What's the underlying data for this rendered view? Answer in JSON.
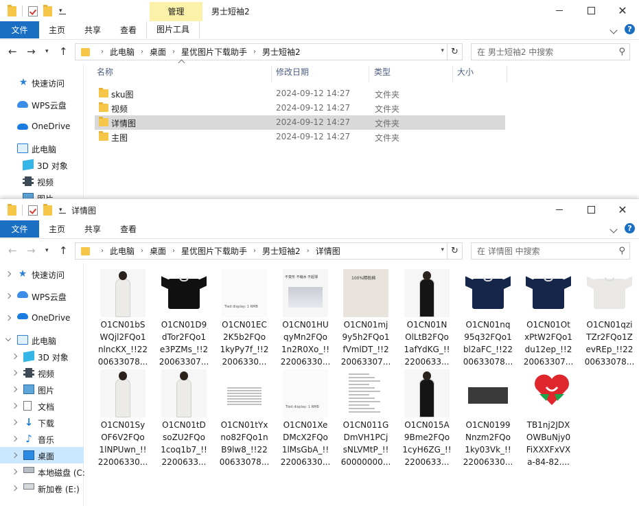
{
  "back_window": {
    "title": "男士短袖2",
    "manage_tab": "管理",
    "tabs": [
      "文件",
      "主页",
      "共享",
      "查看",
      "图片工具"
    ],
    "address": [
      "此电脑",
      "桌面",
      "星优图片下载助手",
      "男士短袖2"
    ],
    "search_placeholder": "在 男士短袖2 中搜索",
    "nav_items": [
      "快速访问",
      "WPS云盘",
      "OneDrive",
      "此电脑",
      "3D 对象",
      "视频",
      "图片"
    ],
    "columns": [
      "名称",
      "修改日期",
      "类型",
      "大小"
    ],
    "rows": [
      {
        "name": "sku图",
        "date": "2024-09-12 14:27",
        "type": "文件夹"
      },
      {
        "name": "视频",
        "date": "2024-09-12 14:27",
        "type": "文件夹"
      },
      {
        "name": "详情图",
        "date": "2024-09-12 14:27",
        "type": "文件夹"
      },
      {
        "name": "主图",
        "date": "2024-09-12 14:27",
        "type": "文件夹"
      }
    ]
  },
  "front_window": {
    "title": "详情图",
    "tabs": [
      "文件",
      "主页",
      "共享",
      "查看"
    ],
    "address": [
      "此电脑",
      "桌面",
      "星优图片下载助手",
      "男士短袖2",
      "详情图"
    ],
    "search_placeholder": "在 详情图 中搜索",
    "nav_items": [
      "快速访问",
      "WPS云盘",
      "OneDrive",
      "此电脑",
      "3D 对象",
      "视频",
      "图片",
      "文档",
      "下载",
      "音乐",
      "桌面",
      "本地磁盘 (C:",
      "新加卷 (E:)"
    ],
    "files": [
      {
        "lines": [
          "O1CN01bS",
          "WQjl2FQo1",
          "nlncKX_!!22",
          "00633078..."
        ],
        "kind": "model-white"
      },
      {
        "lines": [
          "O1CN01D9",
          "dTor2FQo1",
          "e3PZMs_!!2",
          "20063307..."
        ],
        "kind": "tee-black"
      },
      {
        "lines": [
          "O1CN01EC",
          "2K5b2FQo",
          "1kyPy7f_!!2",
          "2006330..."
        ],
        "kind": "blank"
      },
      {
        "lines": [
          "O1CN01HU",
          "qyMn2FQo",
          "1n2R0Xo_!!",
          "22006330..."
        ],
        "kind": "doc-photo"
      },
      {
        "lines": [
          "O1CN01mj",
          "9y5h2FQo1",
          "fVmlDT_!!2",
          "20063307..."
        ],
        "kind": "fabric"
      },
      {
        "lines": [
          "O1CN01N",
          "OlLtB2FQo",
          "1afYdKG_!!",
          "2200633..."
        ],
        "kind": "model-black"
      },
      {
        "lines": [
          "O1CN01nq",
          "95q32FQo1",
          "bl2aFC_!!22",
          "00633078..."
        ],
        "kind": "tee-navy"
      },
      {
        "lines": [
          "O1CN01Ot",
          "xPtW2FQo1",
          "du12ep_!!2",
          "20063307..."
        ],
        "kind": "tee-navy"
      },
      {
        "lines": [
          "O1CN01qzi",
          "TZr2FQo1Z",
          "evREp_!!22",
          "00633078..."
        ],
        "kind": "tee-white"
      },
      {
        "lines": [
          "O1CN01Sy",
          "OF6V2FQo",
          "1lNPUwn_!!",
          "22006330..."
        ],
        "kind": "model-white"
      },
      {
        "lines": [
          "O1CN01tD",
          "soZU2FQo",
          "1coq1b7_!!",
          "2200633..."
        ],
        "kind": "model-white"
      },
      {
        "lines": [
          "O1CN01tYx",
          "no82FQo1n",
          "B9lw8_!!22",
          "00633078..."
        ],
        "kind": "table"
      },
      {
        "lines": [
          "O1CN01Xe",
          "DMcX2FQo",
          "1lMsGbA_!!",
          "22006330..."
        ],
        "kind": "blank"
      },
      {
        "lines": [
          "O1CN011G",
          "DmVH1PCj",
          "sNLVMtP_!!",
          "60000000..."
        ],
        "kind": "doc"
      },
      {
        "lines": [
          "O1CN015A",
          "9Bme2FQo",
          "1cyH6ZG_!!",
          "2200633..."
        ],
        "kind": "model-black"
      },
      {
        "lines": [
          "O1CN0199",
          "Nnzm2FQo",
          "1ky03Vk_!!",
          "22006330..."
        ],
        "kind": "banner"
      },
      {
        "lines": [
          "TB1nj2JDX",
          "OWBuNjy0",
          "FiXXXFxVX",
          "a-84-82...."
        ],
        "kind": "heart"
      }
    ],
    "thumb_captions": {
      "doc_photo_title": "不变形 不缩水 不起球",
      "fabric_title": "100%精梳棉",
      "blank_text": "Tied display: 1 RMB"
    }
  },
  "colors": {
    "accent": "#1a6fc3",
    "folder": "#f6c648",
    "selection": "#cce8ff",
    "manage": "#fbf1a9"
  }
}
